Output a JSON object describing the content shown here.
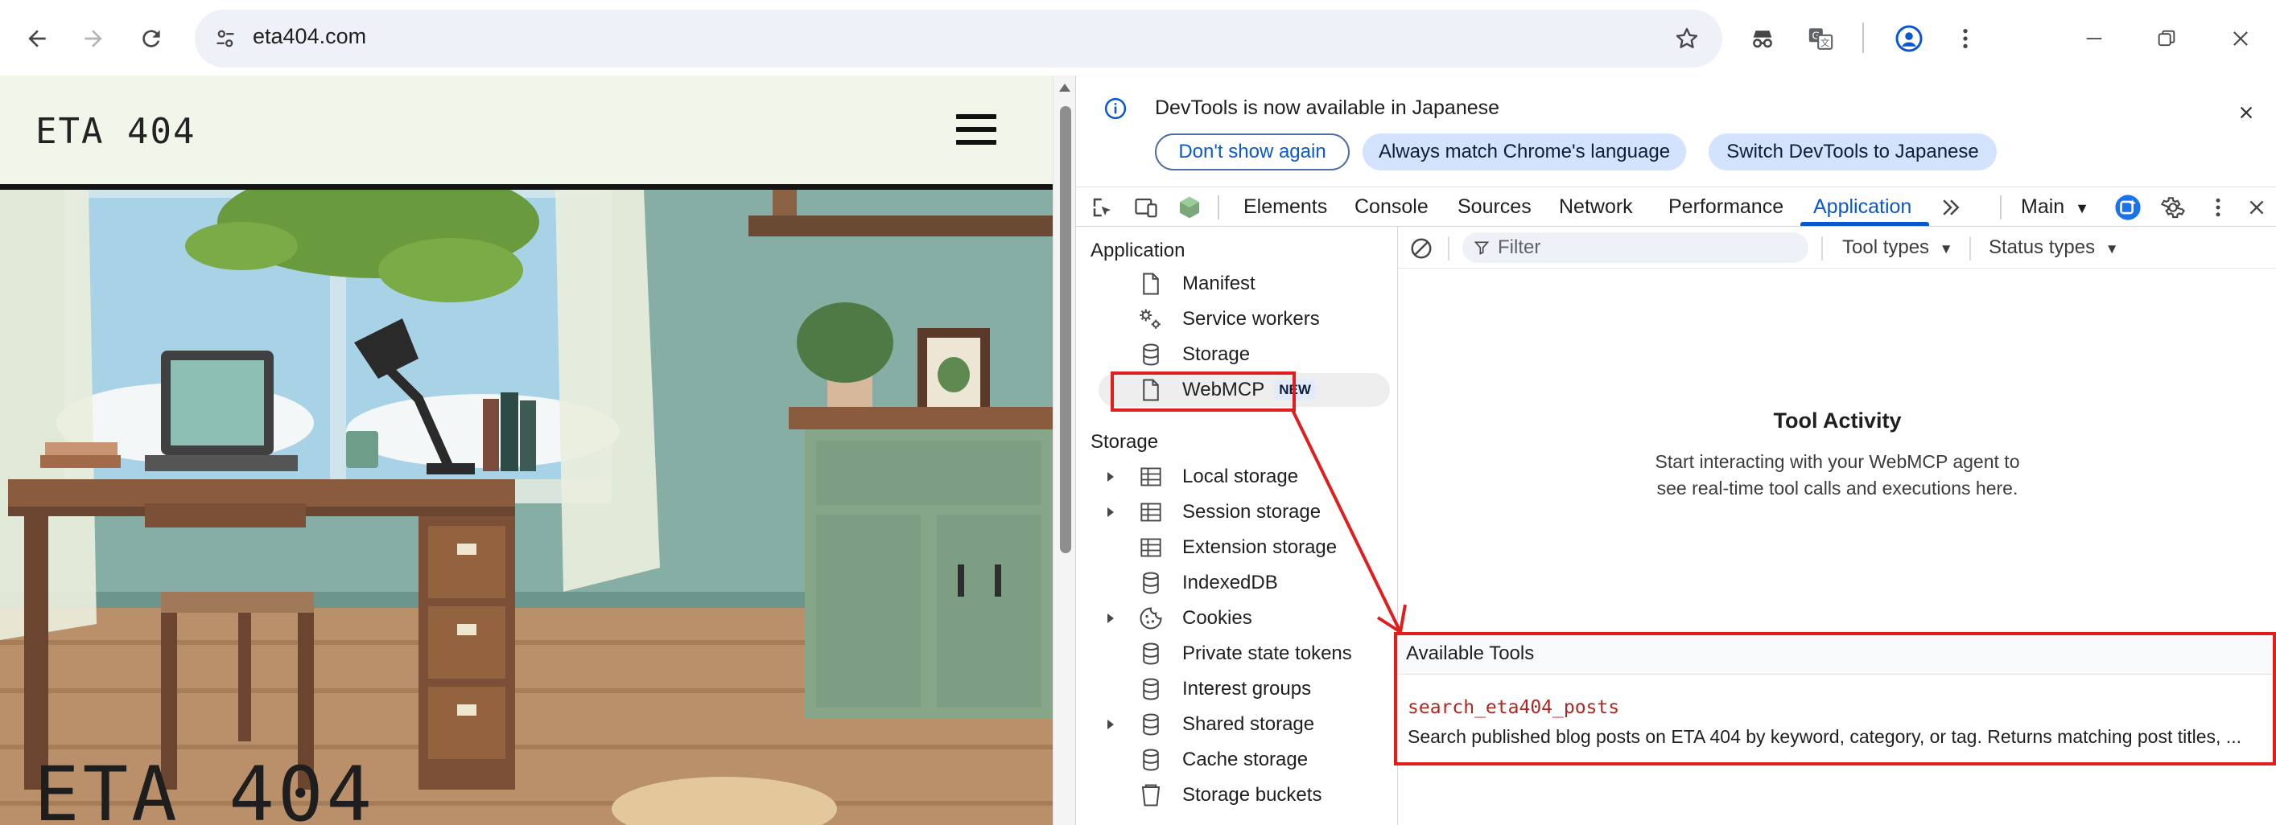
{
  "browser": {
    "url": "eta404.com"
  },
  "site": {
    "logo": "ETA 404",
    "hero_title": "ETA 404"
  },
  "infobar": {
    "message": "DevTools is now available in Japanese",
    "buttons": {
      "dont_show": "Don't show again",
      "always_match": "Always match Chrome's language",
      "switch": "Switch DevTools to Japanese"
    }
  },
  "toolbar": {
    "tabs": [
      "Elements",
      "Console",
      "Sources",
      "Network",
      "Performance",
      "Application"
    ],
    "active_tab": "Application",
    "context_select": "Main"
  },
  "sidebar": {
    "application_heading": "Application",
    "application_items": [
      "Manifest",
      "Service workers",
      "Storage",
      "WebMCP"
    ],
    "new_badge": "NEW",
    "storage_heading": "Storage",
    "storage_items": [
      "Local storage",
      "Session storage",
      "Extension storage",
      "IndexedDB",
      "Cookies",
      "Private state tokens",
      "Interest groups",
      "Shared storage",
      "Cache storage",
      "Storage buckets"
    ]
  },
  "main": {
    "filter_placeholder": "Filter",
    "tool_types": "Tool types",
    "status_types": "Status types",
    "activity_title": "Tool Activity",
    "activity_desc_line1": "Start interacting with your WebMCP agent to",
    "activity_desc_line2": "see real-time tool calls and executions here.",
    "available_tools_heading": "Available Tools",
    "tool": {
      "name": "search_eta404_posts",
      "description": "Search published blog posts on ETA 404 by keyword, category, or tag. Returns matching post titles, ..."
    }
  },
  "colors": {
    "accent": "#0b57d0",
    "annotation": "#e01e1e",
    "tool_name": "#b3261e"
  }
}
